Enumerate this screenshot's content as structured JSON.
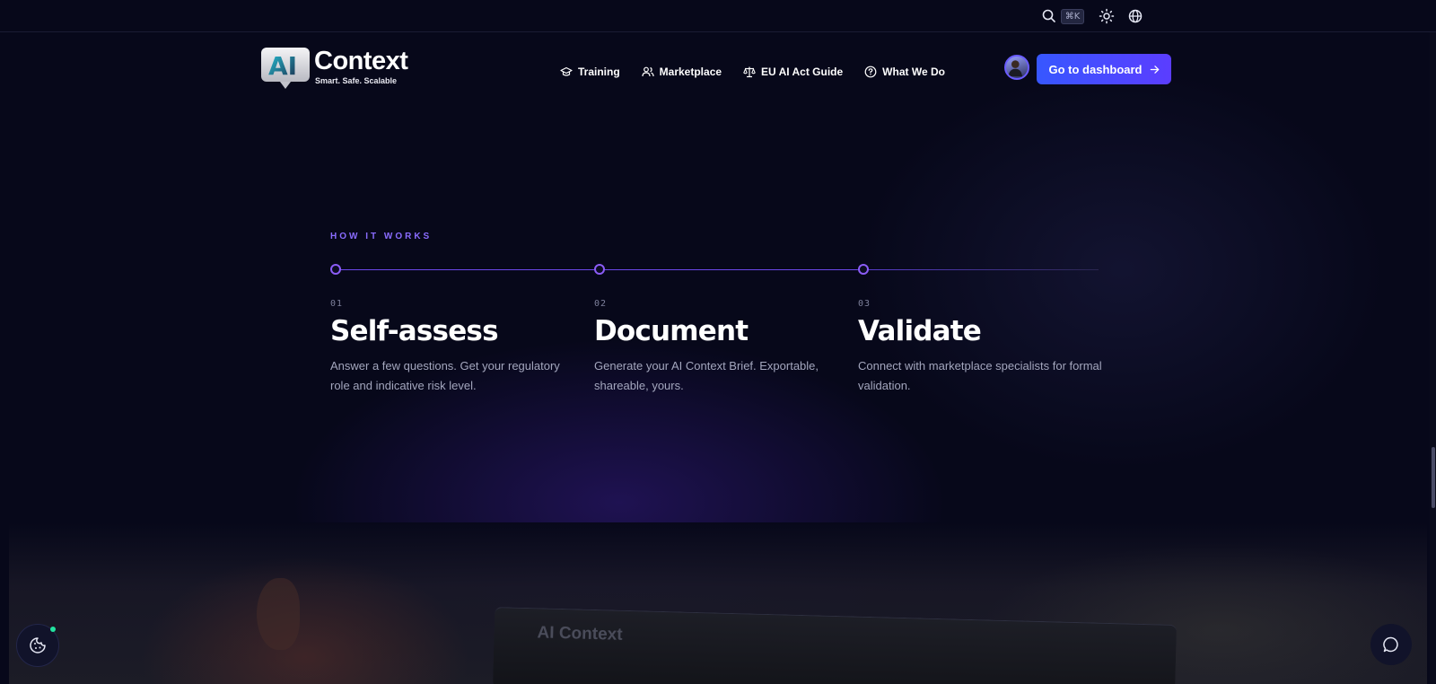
{
  "utility": {
    "search_icon": "search-icon",
    "shortcut": "⌘K",
    "theme_icon": "sun-icon",
    "language_icon": "globe-icon"
  },
  "brand": {
    "badge_text": "AI",
    "title": "Context",
    "tagline": "Smart. Safe. Scalable"
  },
  "nav": {
    "items": [
      {
        "label": "Training",
        "icon": "graduation-cap-icon"
      },
      {
        "label": "Marketplace",
        "icon": "users-icon"
      },
      {
        "label": "EU AI Act Guide",
        "icon": "scale-icon"
      },
      {
        "label": "What We Do",
        "icon": "help-circle-icon"
      }
    ]
  },
  "header": {
    "dashboard_label": "Go to dashboard"
  },
  "how_it_works": {
    "label": "HOW IT WORKS",
    "steps": [
      {
        "num": "01",
        "title": "Self-assess",
        "desc": "Answer a few questions. Get your regulatory role and indicative risk level."
      },
      {
        "num": "02",
        "title": "Document",
        "desc": "Generate your AI Context Brief. Exportable, shareable, yours."
      },
      {
        "num": "03",
        "title": "Validate",
        "desc": "Connect with marketplace specialists for formal validation."
      }
    ]
  },
  "photo": {
    "laptop_brand": "AI Context"
  },
  "colors": {
    "accent": "#8b5cf6",
    "button_start": "#3757ff",
    "button_end": "#5b3dff",
    "background": "#07081a",
    "status_dot": "#22e3a0"
  }
}
